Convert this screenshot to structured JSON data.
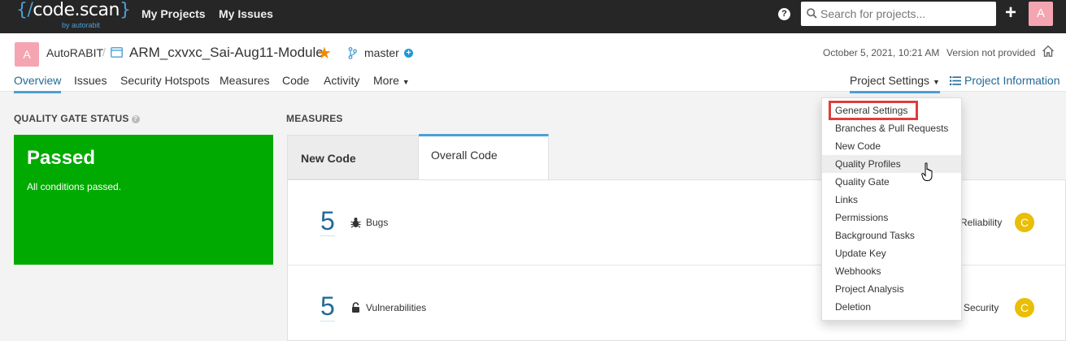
{
  "topbar": {
    "logo_text": "code.scan",
    "logo_sub": "by autorabit",
    "nav": [
      "My Projects",
      "My Issues"
    ],
    "help_icon": "help-icon",
    "search_placeholder": "Search for projects...",
    "add_icon": "plus-icon",
    "avatar": "A"
  },
  "project": {
    "org_avatar": "A",
    "org_name": "AutoRABIT",
    "separator": "/",
    "name": "ARM_cxvxc_Sai-Aug11-Module",
    "branch": "master",
    "date": "October 5, 2021, 10:21 AM",
    "version": "Version not provided",
    "tabs": [
      "Overview",
      "Issues",
      "Security Hotspots",
      "Measures",
      "Code",
      "Activity",
      "More"
    ],
    "active_tab": "Overview",
    "settings_label": "Project Settings",
    "info_label": "Project Information"
  },
  "quality_gate": {
    "title": "QUALITY GATE STATUS",
    "status": "Passed",
    "message": "All conditions passed.",
    "color": "#00aa00"
  },
  "measures": {
    "title": "MEASURES",
    "tabs": [
      "New Code",
      "Overall Code"
    ],
    "active_tab": "Overall Code",
    "rows": [
      {
        "value": "5",
        "label": "Bugs",
        "icon": "bug-icon",
        "right_label": "Reliability",
        "rating": "C"
      },
      {
        "value": "5",
        "label": "Vulnerabilities",
        "icon": "lock-icon",
        "right_label": "Security",
        "rating": "C"
      }
    ],
    "rating_color": "#eabe06"
  },
  "settings_menu": {
    "items": [
      "General Settings",
      "Branches & Pull Requests",
      "New Code",
      "Quality Profiles",
      "Quality Gate",
      "Links",
      "Permissions",
      "Background Tasks",
      "Update Key",
      "Webhooks",
      "Project Analysis",
      "Deletion"
    ],
    "highlighted": "General Settings",
    "hovered": "Quality Profiles"
  }
}
